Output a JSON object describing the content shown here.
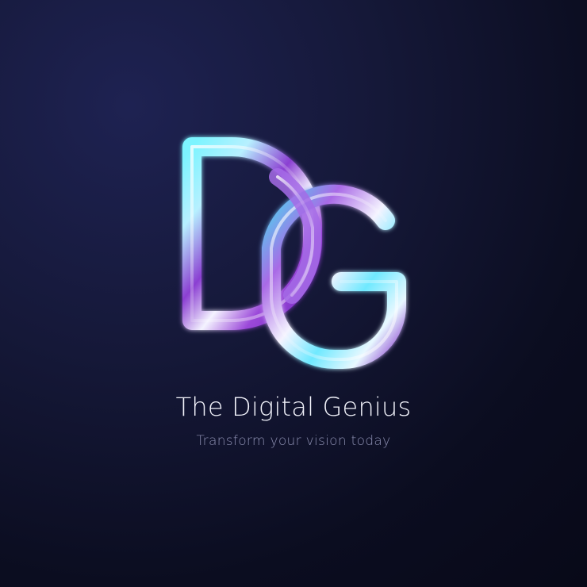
{
  "brand": {
    "monogram": "DG",
    "name": "The Digital Genius",
    "tagline": "Transform your vision today"
  },
  "colors": {
    "background": "#101330",
    "accent_cyan": "#66eaff",
    "accent_purple": "#9b48d9",
    "highlight_white": "#f4f3ff",
    "text_primary": "#f2f3fb",
    "text_secondary": "#8c8fb1"
  }
}
